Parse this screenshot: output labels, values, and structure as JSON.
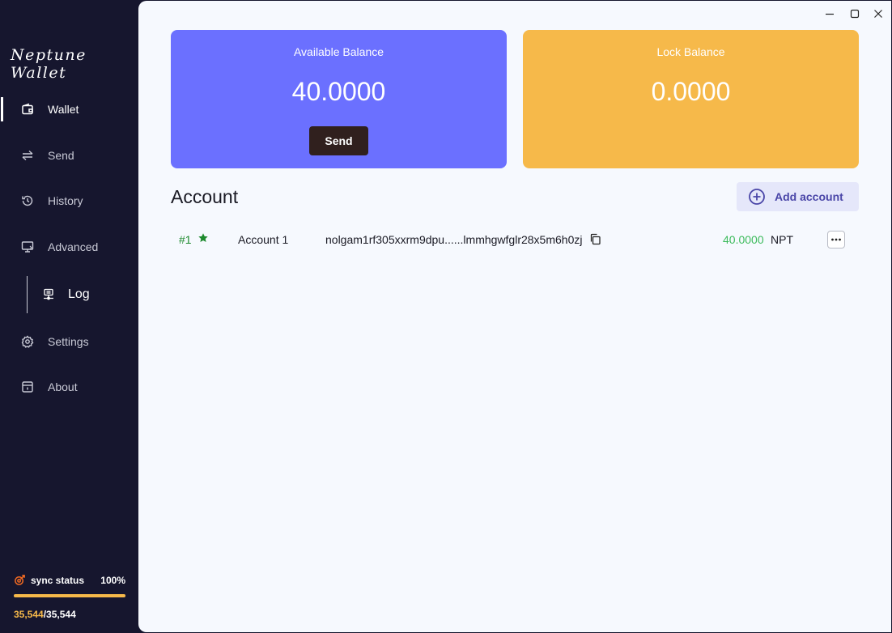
{
  "app": {
    "logo": "Neptune Wallet"
  },
  "sidebar": {
    "items": [
      {
        "label": "Wallet",
        "icon": "wallet-icon"
      },
      {
        "label": "Send",
        "icon": "transfer-icon"
      },
      {
        "label": "History",
        "icon": "history-icon"
      },
      {
        "label": "Advanced",
        "icon": "monitor-icon"
      },
      {
        "label": "Settings",
        "icon": "gear-icon"
      },
      {
        "label": "About",
        "icon": "info-box-icon"
      }
    ],
    "sub_item": {
      "label": "Log",
      "icon": "network-icon"
    },
    "active": "Wallet"
  },
  "sync": {
    "label": "sync status",
    "percent_text": "100%",
    "progress": 1.0,
    "current": "35,544",
    "separator": "/",
    "total": "35,544"
  },
  "balances": {
    "available": {
      "title": "Available Balance",
      "value": "40.0000",
      "color": "#6b70ff"
    },
    "lock": {
      "title": "Lock Balance",
      "value": "0.0000",
      "color": "#f6b94a"
    },
    "send_label": "Send"
  },
  "account_section": {
    "title": "Account",
    "add_label": "Add account"
  },
  "accounts": [
    {
      "index": "#1",
      "name": "Account 1",
      "address": "nolgam1rf305xxrm9dpu......lmmhgwfglr28x5m6h0zj",
      "balance": "40.0000",
      "unit": "NPT"
    }
  ]
}
